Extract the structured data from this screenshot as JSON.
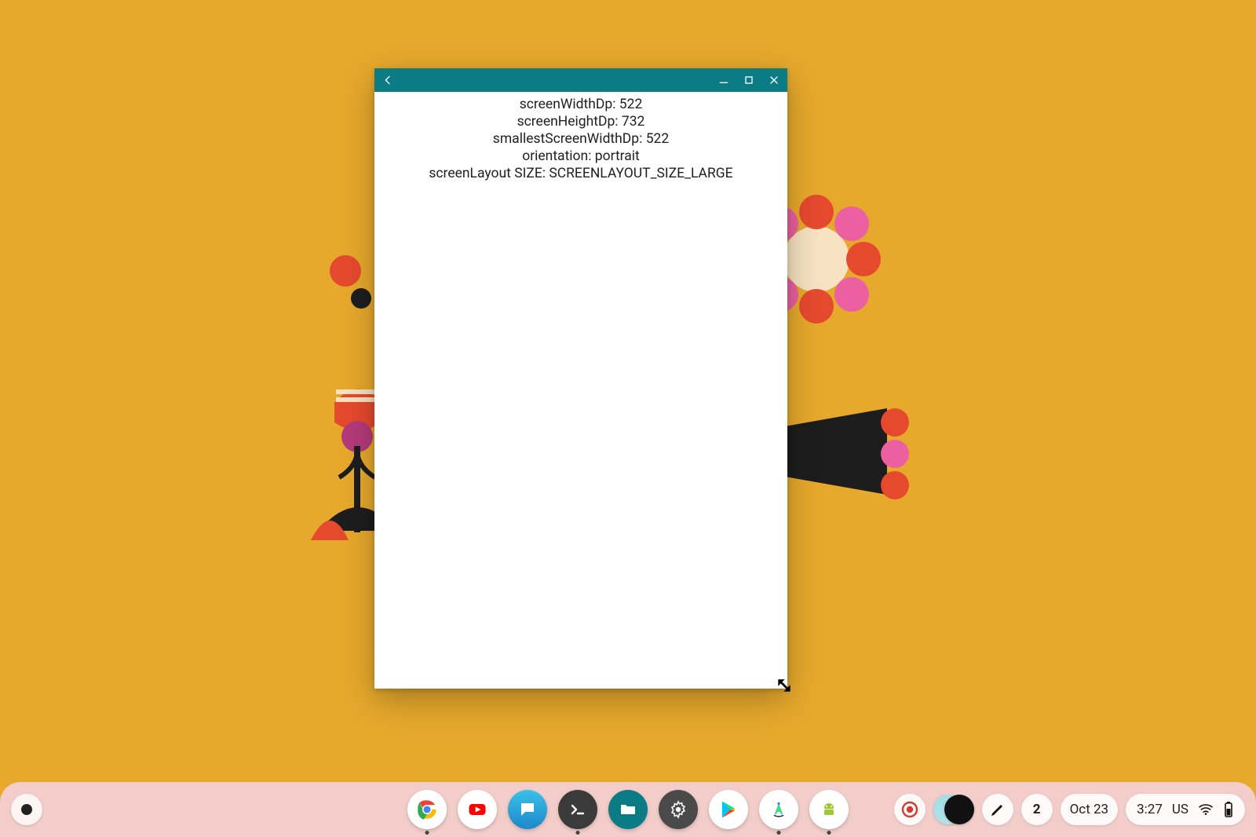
{
  "wallpaper": {
    "accent": "#e7a92c"
  },
  "app_window": {
    "titlebar_color": "#0b7b85",
    "lines": [
      "screenWidthDp: 522",
      "screenHeightDp: 732",
      "smallestScreenWidthDp: 522",
      "orientation: portrait",
      "screenLayout SIZE: SCREENLAYOUT_SIZE_LARGE"
    ]
  },
  "shelf": {
    "apps": [
      {
        "name": "chrome",
        "running": true
      },
      {
        "name": "youtube",
        "running": false
      },
      {
        "name": "messages",
        "running": false
      },
      {
        "name": "terminal",
        "running": true
      },
      {
        "name": "files",
        "running": false
      },
      {
        "name": "settings",
        "running": false
      },
      {
        "name": "play-store",
        "running": false
      },
      {
        "name": "android-studio",
        "running": true
      },
      {
        "name": "android-emulator",
        "running": true
      }
    ]
  },
  "tray": {
    "record_active": true,
    "notifications_count": "2",
    "date": "Oct 23",
    "time": "3:27",
    "keyboard": "US"
  }
}
